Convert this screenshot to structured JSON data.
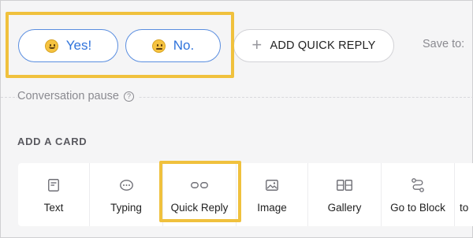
{
  "quick_replies": [
    {
      "emoji": "smiling-face",
      "label": "Yes!"
    },
    {
      "emoji": "neutral-face",
      "label": "No."
    }
  ],
  "add_quick_reply_label": "ADD QUICK REPLY",
  "save_to_label": "Save to:",
  "conversation_pause_label": "Conversation pause",
  "add_card_title": "ADD A CARD",
  "cards": [
    {
      "icon": "text-icon",
      "label": "Text"
    },
    {
      "icon": "typing-icon",
      "label": "Typing"
    },
    {
      "icon": "quick-reply-icon",
      "label": "Quick Reply"
    },
    {
      "icon": "image-icon",
      "label": "Image"
    },
    {
      "icon": "gallery-icon",
      "label": "Gallery"
    },
    {
      "icon": "go-to-block-icon",
      "label": "Go to Block"
    },
    {
      "icon": "",
      "label": "to"
    }
  ],
  "colors": {
    "accent_blue": "#2f73db",
    "highlight": "#f0c13d",
    "background": "#f5f5f6"
  }
}
